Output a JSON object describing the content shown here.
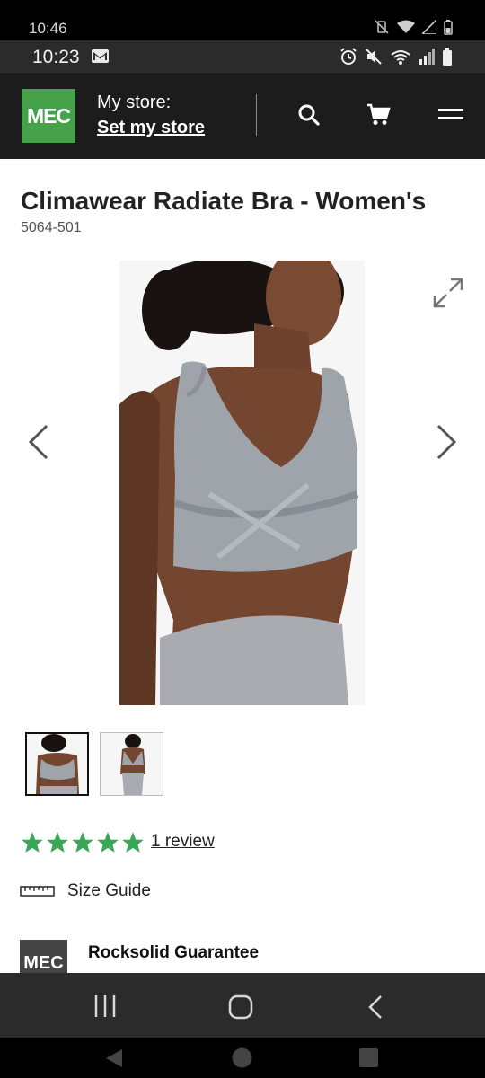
{
  "outer_status": {
    "time": "10:46"
  },
  "inner_status": {
    "time": "10:23"
  },
  "header": {
    "logo": "MEC",
    "store_label": "My store:",
    "store_link": "Set my store"
  },
  "product": {
    "title": "Climawear Radiate Bra - Women's",
    "sku": "5064-501",
    "rating": 5,
    "rating_max": 5,
    "review_link": "1 review",
    "size_guide": "Size Guide"
  },
  "guarantee": {
    "logo": "MEC",
    "title": "Rocksolid Guarantee"
  },
  "colors": {
    "brand_green": "#45a14a",
    "star_green": "#3aa757",
    "header_bg": "#1c1c1c"
  }
}
